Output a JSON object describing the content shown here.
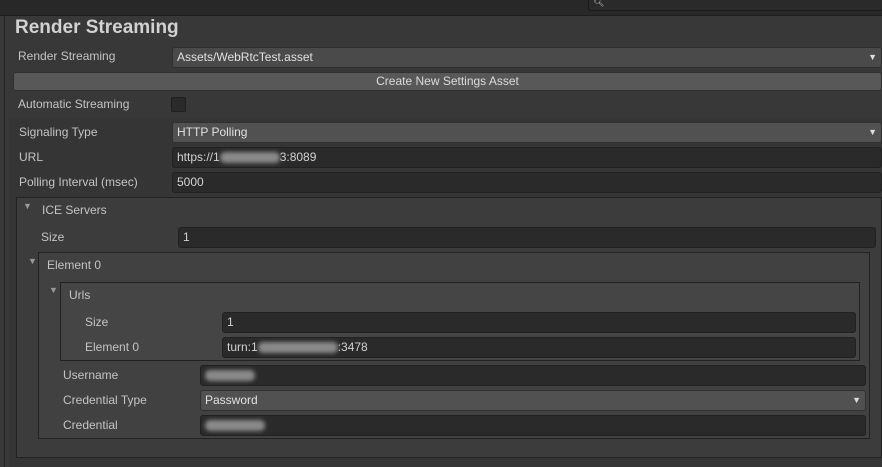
{
  "title": "Render Streaming",
  "render_streaming": {
    "label": "Render Streaming",
    "value": "Assets/WebRtcTest.asset"
  },
  "create_button": "Create New Settings Asset",
  "automatic_streaming": {
    "label": "Automatic Streaming",
    "checked": false
  },
  "signaling_type": {
    "label": "Signaling Type",
    "value": "HTTP Polling"
  },
  "url": {
    "label": "URL",
    "value_prefix": "https://1",
    "value_suffix": "3:8089"
  },
  "polling_interval": {
    "label": "Polling Interval (msec)",
    "value": "5000"
  },
  "ice_servers": {
    "label": "ICE Servers",
    "size_label": "Size",
    "size": "1",
    "element0": {
      "label": "Element 0",
      "urls": {
        "label": "Urls",
        "size_label": "Size",
        "size": "1",
        "element0_label": "Element 0",
        "element0_prefix": "turn:1",
        "element0_suffix": ":3478"
      },
      "username_label": "Username",
      "credential_type_label": "Credential Type",
      "credential_type": "Password",
      "credential_label": "Credential"
    }
  }
}
